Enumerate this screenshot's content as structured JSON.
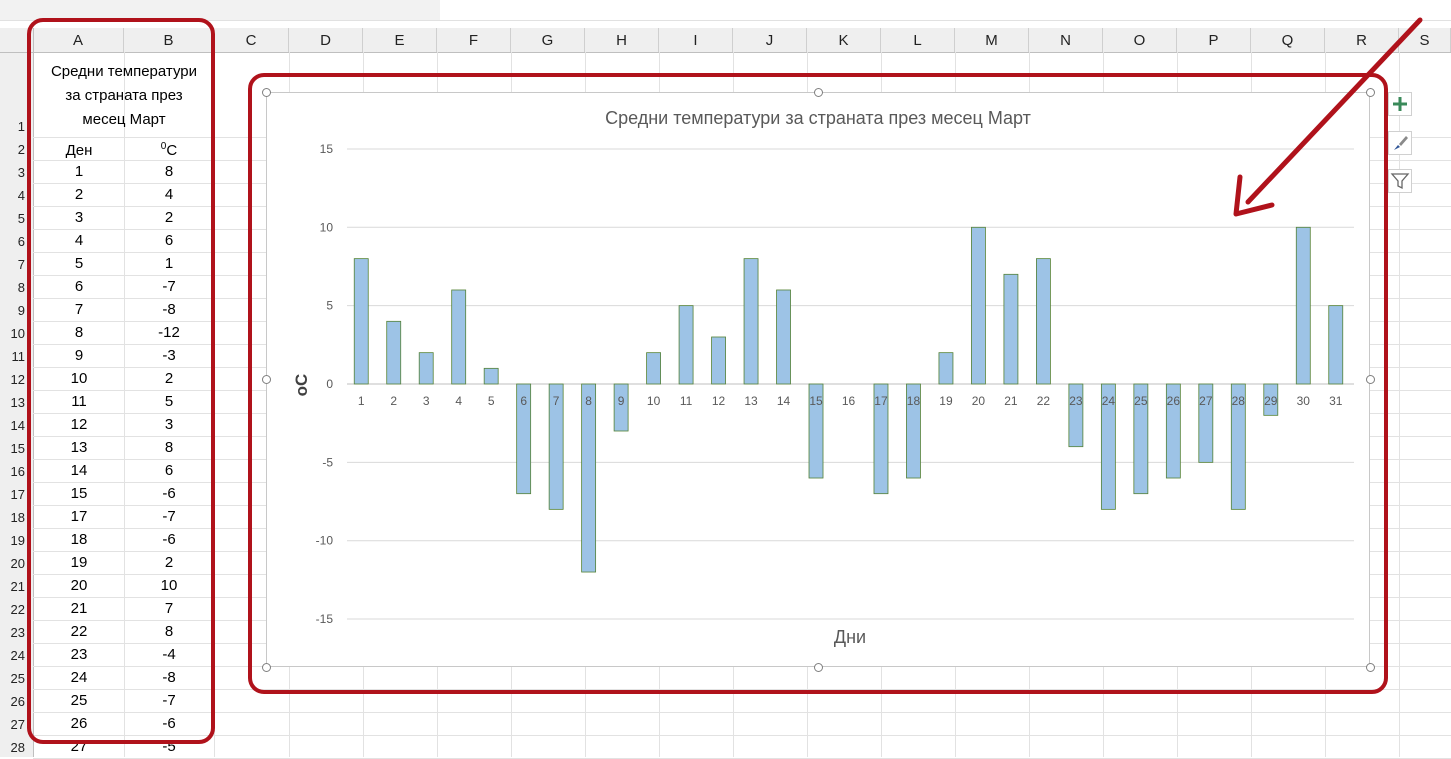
{
  "sheet": {
    "columns": [
      "A",
      "B",
      "C",
      "D",
      "E",
      "F",
      "G",
      "H",
      "I",
      "J",
      "K",
      "L",
      "M",
      "N",
      "O",
      "P",
      "Q",
      "R",
      "S"
    ],
    "rows": [
      "1",
      "2",
      "3",
      "4",
      "5",
      "6",
      "7",
      "8",
      "9",
      "10",
      "11",
      "12",
      "13",
      "14",
      "15",
      "16",
      "17",
      "18",
      "19",
      "20",
      "21",
      "22",
      "23",
      "24",
      "25",
      "26",
      "27",
      "28"
    ],
    "title_lines": [
      "Средни температури",
      "за страната през",
      "месец Март"
    ],
    "header_day": "Ден",
    "header_temp_sup": "0",
    "header_temp_unit": "С",
    "table": [
      [
        "1",
        "8"
      ],
      [
        "2",
        "4"
      ],
      [
        "3",
        "2"
      ],
      [
        "4",
        "6"
      ],
      [
        "5",
        "1"
      ],
      [
        "6",
        "-7"
      ],
      [
        "7",
        "-8"
      ],
      [
        "8",
        "-12"
      ],
      [
        "9",
        "-3"
      ],
      [
        "10",
        "2"
      ],
      [
        "11",
        "5"
      ],
      [
        "12",
        "3"
      ],
      [
        "13",
        "8"
      ],
      [
        "14",
        "6"
      ],
      [
        "15",
        "-6"
      ],
      [
        "17",
        "-7"
      ],
      [
        "18",
        "-6"
      ],
      [
        "19",
        "2"
      ],
      [
        "20",
        "10"
      ],
      [
        "21",
        "7"
      ],
      [
        "22",
        "8"
      ],
      [
        "23",
        "-4"
      ],
      [
        "24",
        "-8"
      ],
      [
        "25",
        "-7"
      ],
      [
        "26",
        "-6"
      ],
      [
        "27",
        "-5"
      ]
    ]
  },
  "chart_buttons": [
    {
      "name": "chart-elements-button",
      "icon": "plus-icon",
      "glyph": "+"
    },
    {
      "name": "chart-styles-button",
      "icon": "brush-icon",
      "glyph": "✎"
    },
    {
      "name": "chart-filters-button",
      "icon": "filter-icon",
      "glyph": "⏷"
    }
  ],
  "colors": {
    "bar_fill": "#9dc3e6",
    "bar_stroke": "#548235",
    "highlight": "#b0121b",
    "gridline": "#d9d9d9"
  },
  "chart_data": {
    "type": "bar",
    "title": "Средни температури за страната през месец Март",
    "xlabel": "Дни",
    "ylabel": "oC",
    "categories": [
      "1",
      "2",
      "3",
      "4",
      "5",
      "6",
      "7",
      "8",
      "9",
      "10",
      "11",
      "12",
      "13",
      "14",
      "15",
      "16",
      "17",
      "18",
      "19",
      "20",
      "21",
      "22",
      "23",
      "24",
      "25",
      "26",
      "27",
      "28",
      "29",
      "30",
      "31"
    ],
    "values": [
      8,
      4,
      2,
      6,
      1,
      -7,
      -8,
      -12,
      -3,
      2,
      5,
      3,
      8,
      6,
      -6,
      0,
      -7,
      -6,
      2,
      10,
      7,
      8,
      -4,
      -8,
      -7,
      -6,
      -5,
      -8,
      -2,
      10,
      5
    ],
    "ylim": [
      -15,
      15
    ],
    "yticks": [
      "15",
      "10",
      "5",
      "0",
      "-5",
      "-10",
      "-15"
    ],
    "grid": true,
    "legend": "none"
  }
}
